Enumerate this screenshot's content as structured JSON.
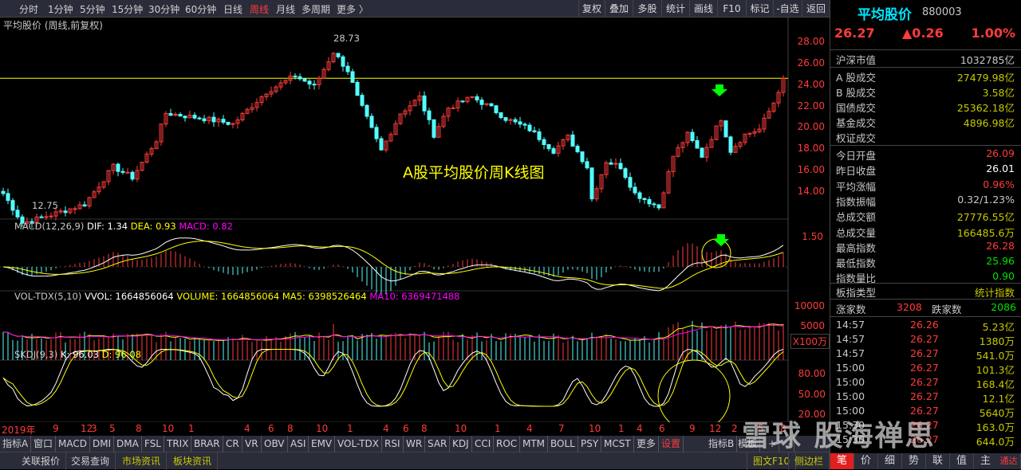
{
  "toolbar": {
    "periods": [
      "分时",
      "1分钟",
      "5分钟",
      "15分钟",
      "30分钟",
      "60分钟",
      "日线",
      "周线",
      "月线",
      "多周期",
      "更多 〉"
    ],
    "active_period": "周线",
    "buttons": [
      "复权",
      "叠加",
      "多股",
      "统计",
      "画线",
      "F10",
      "标记",
      "-自选",
      "返回"
    ]
  },
  "chart": {
    "title": "平均股价 (周线,前复权)",
    "annotation": "A股平均股价周K线图",
    "high_label": "28.73",
    "low_label": "12.75",
    "macd_label": "MACD(12,26,9)",
    "dif": "DIF: 1.34",
    "dea": "DEA: 0.93",
    "macd": "MACD: 0.82",
    "vol_label": "VOL-TDX(5,10)",
    "vvol": "VVOL: 1664856064",
    "volume": "VOLUME: 1664856064",
    "ma5": "MA5: 6398526464",
    "ma10": "MA10: 6369471488",
    "skdj_label": "SKDJ(9,3)",
    "k": "K: 96.03",
    "d": "D: 96.08",
    "price_axis": [
      "28.00",
      "26.00",
      "24.00",
      "22.00",
      "20.00",
      "18.00",
      "16.00",
      "14.00"
    ],
    "macd_axis": "1.50",
    "vol_axis": [
      "10000",
      "5000"
    ],
    "vol_unit": "X100万",
    "skdj_axis": [
      "80.00",
      "50.00",
      "20.00"
    ],
    "time_axis": [
      "2019年",
      "9",
      "12",
      "3",
      "5",
      "8",
      "10",
      "1",
      "4",
      "6",
      "8",
      "10",
      "1",
      "4",
      "6",
      "8",
      "10",
      "1",
      "4",
      "7",
      "10",
      "1",
      "4",
      "6",
      "9",
      "12",
      "2",
      "5",
      "8"
    ],
    "colors": {
      "up": "#ff3b3b",
      "down": "#54ffff",
      "ma": "#ffff00",
      "ma10": "#ff00ff",
      "hline": "#ffff00"
    }
  },
  "chart_data": {
    "type": "candlestick",
    "current_close": 26.27,
    "ylim": [
      13,
      29.5
    ],
    "keypoints": [
      [
        0,
        15.5
      ],
      [
        4,
        12.75
      ],
      [
        10,
        13.5
      ],
      [
        17,
        14.5
      ],
      [
        23,
        18
      ],
      [
        27,
        17
      ],
      [
        32,
        20.5
      ],
      [
        34,
        23
      ],
      [
        42,
        22.5
      ],
      [
        48,
        22
      ],
      [
        55,
        25
      ],
      [
        61,
        26.5
      ],
      [
        65,
        25.5
      ],
      [
        69,
        28.73
      ],
      [
        72,
        27
      ],
      [
        74,
        24.5
      ],
      [
        79,
        19.5
      ],
      [
        83,
        23
      ],
      [
        87,
        24.5
      ],
      [
        90,
        21
      ],
      [
        93,
        23.5
      ],
      [
        98,
        24.5
      ],
      [
        102,
        23.5
      ],
      [
        105,
        22.5
      ],
      [
        110,
        21.5
      ],
      [
        115,
        19.5
      ],
      [
        118,
        20.8
      ],
      [
        122,
        18
      ],
      [
        123,
        15
      ],
      [
        126,
        18.5
      ],
      [
        129,
        18
      ],
      [
        132,
        15.5
      ],
      [
        137,
        14.2
      ],
      [
        140,
        19
      ],
      [
        143,
        21
      ],
      [
        146,
        19
      ],
      [
        150,
        22.5
      ],
      [
        152,
        19.5
      ],
      [
        155,
        21
      ],
      [
        158,
        21.5
      ],
      [
        161,
        24
      ],
      [
        163,
        26.27
      ]
    ]
  },
  "panel": {
    "name": "平均股价",
    "code": "880003",
    "price": "26.27",
    "change": "▲0.26",
    "pct": "1.00%",
    "market_value": {
      "k": "沪深市值",
      "v": "1032785亿"
    },
    "turnover": [
      {
        "k": "A 股成交",
        "v": "27479.98亿"
      },
      {
        "k": "B 股成交",
        "v": "3.58亿"
      },
      {
        "k": "国债成交",
        "v": "25362.18亿"
      },
      {
        "k": "基金成交",
        "v": "4896.98亿"
      },
      {
        "k": "权证成交",
        "v": ""
      }
    ],
    "stats": [
      {
        "k": "今日开盘",
        "v": "26.09",
        "c": "#ff3b3b"
      },
      {
        "k": "昨日收盘",
        "v": "26.01",
        "c": "#ffffff"
      },
      {
        "k": "平均涨幅",
        "v": "0.96%",
        "c": "#ff3b3b"
      },
      {
        "k": "指数振幅",
        "v": "0.32/1.23%",
        "c": "#c8c8c8"
      },
      {
        "k": "总成交额",
        "v": "27776.55亿",
        "c": "#c8c800"
      },
      {
        "k": "总成交量",
        "v": "166485.6万",
        "c": "#c8c800"
      },
      {
        "k": "最高指数",
        "v": "26.28",
        "c": "#ff3b3b"
      },
      {
        "k": "最低指数",
        "v": "25.96",
        "c": "#00e000"
      },
      {
        "k": "指数量比",
        "v": "0.90",
        "c": "#00e000"
      }
    ],
    "type": {
      "k": "板指类型",
      "v": "统计指数"
    },
    "updown": {
      "up_k": "涨家数",
      "up_v": "3208",
      "down_k": "跌家数",
      "down_v": "2086"
    },
    "ticks": [
      [
        "14:57",
        "26.26",
        "5.23亿"
      ],
      [
        "14:57",
        "26.27",
        "1380万"
      ],
      [
        "14:57",
        "26.27",
        "541.0万"
      ],
      [
        "15:00",
        "26.27",
        "101.3亿"
      ],
      [
        "15:00",
        "26.27",
        "168.4亿"
      ],
      [
        "15:00",
        "26.27",
        "12.1亿"
      ],
      [
        "15:00",
        "26.27",
        "5640万"
      ],
      [
        "15:30",
        "26.27",
        "163.0万"
      ],
      [
        "15:30",
        "26.27",
        "644.0万"
      ]
    ],
    "tabs": [
      "笔",
      "价",
      "细",
      "势",
      "联",
      "值",
      "主"
    ],
    "tab_extra": "通达信"
  },
  "indicators": [
    "指标A",
    "窗口",
    "MACD",
    "DMI",
    "DMA",
    "FSL",
    "TRIX",
    "BRAR",
    "CR",
    "VR",
    "OBV",
    "ASI",
    "EMV",
    "VOL-TDX",
    "RSI",
    "WR",
    "SAR",
    "KDJ",
    "CCI",
    "ROC",
    "MTM",
    "BOLL",
    "PSY",
    "MCST",
    "更多",
    "设置"
  ],
  "indicators_right": [
    "指标B",
    "模板",
    "+",
    "-"
  ],
  "bottom": {
    "left": [
      "关联报价",
      "交易查询",
      "市场资讯",
      "板块资讯"
    ],
    "right": [
      "图文F10",
      "侧边栏"
    ]
  },
  "watermark": "雪球  股海禅思"
}
